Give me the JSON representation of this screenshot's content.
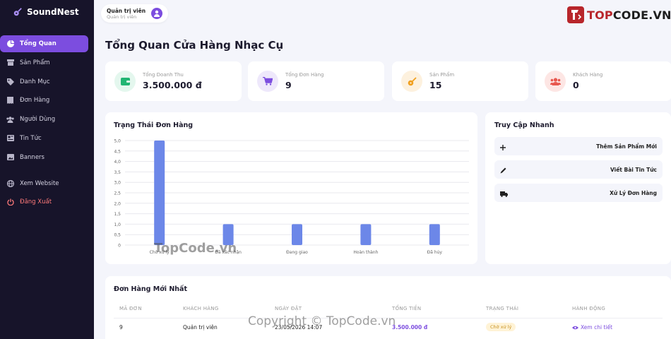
{
  "brand": {
    "name": "SoundNest"
  },
  "sidebar": {
    "items": [
      {
        "label": "Tổng Quan",
        "icon": "chart-pie-icon",
        "active": true
      },
      {
        "label": "Sản Phẩm",
        "icon": "box-icon"
      },
      {
        "label": "Danh Mục",
        "icon": "tags-icon"
      },
      {
        "label": "Đơn Hàng",
        "icon": "receipt-icon"
      },
      {
        "label": "Người Dùng",
        "icon": "users-icon"
      },
      {
        "label": "Tin Tức",
        "icon": "newspaper-icon"
      },
      {
        "label": "Banners",
        "icon": "image-icon"
      }
    ],
    "footer": [
      {
        "label": "Xem Website",
        "icon": "globe-icon"
      },
      {
        "label": "Đăng Xuất",
        "icon": "power-icon"
      }
    ]
  },
  "user": {
    "name": "Quản trị viên",
    "role": "Quản trị viên"
  },
  "watermark_logo": {
    "prefix": "TOP",
    "suffix": "CODE.VN"
  },
  "page": {
    "title": "Tổng Quan Cửa Hàng Nhạc Cụ"
  },
  "stats": [
    {
      "label": "Tổng Doanh Thu",
      "value": "3.500.000 đ",
      "icon": "wallet-icon",
      "color": "#22b573",
      "bg": "#e4f7ee"
    },
    {
      "label": "Tổng Đơn Hàng",
      "value": "9",
      "icon": "cart-icon",
      "color": "#7c4ddf",
      "bg": "#eee8fb"
    },
    {
      "label": "Sản Phẩm",
      "value": "15",
      "icon": "guitar-icon",
      "color": "#f0a020",
      "bg": "#fdf1de"
    },
    {
      "label": "Khách Hàng",
      "value": "0",
      "icon": "users-icon",
      "color": "#e8584f",
      "bg": "#fde6e4"
    }
  ],
  "chart_section": {
    "title": "Trạng Thái Đơn Hàng"
  },
  "chart_data": {
    "type": "bar",
    "categories": [
      "Chờ xử lý",
      "Đã xác nhận",
      "Đang giao",
      "Hoàn thành",
      "Đã hủy"
    ],
    "values": [
      5,
      1,
      1,
      1,
      1
    ],
    "ylim": [
      0,
      5
    ],
    "yticks": [
      "0",
      "0,5",
      "1,0",
      "1,5",
      "2,0",
      "2,5",
      "3,0",
      "3,5",
      "4,0",
      "4,5",
      "5,0"
    ],
    "color": "#6c87e8",
    "grid": true
  },
  "quick": {
    "title": "Truy Cập Nhanh",
    "items": [
      {
        "label": "Thêm Sản Phẩm Mới",
        "icon": "plus-icon"
      },
      {
        "label": "Viết Bài Tin Tức",
        "icon": "pen-icon"
      },
      {
        "label": "Xử Lý Đơn Hàng",
        "icon": "truck-icon"
      }
    ]
  },
  "orders": {
    "title": "Đơn Hàng Mới Nhất",
    "headers": [
      "MÃ ĐƠN",
      "KHÁCH HÀNG",
      "NGÀY ĐẶT",
      "TỔNG TIỀN",
      "TRẠNG THÁI",
      "HÀNH ĐỘNG"
    ],
    "rows": [
      {
        "id": "9",
        "customer": "Quản trị viên",
        "date": "23/05/2026 14:07",
        "total": "3.500.000 đ",
        "status": "Chờ xử lý",
        "action": "Xem chi tiết"
      }
    ]
  },
  "overlays": {
    "topcode": "TopCode.vn",
    "copyright": "Copyright © TopCode.vn"
  }
}
